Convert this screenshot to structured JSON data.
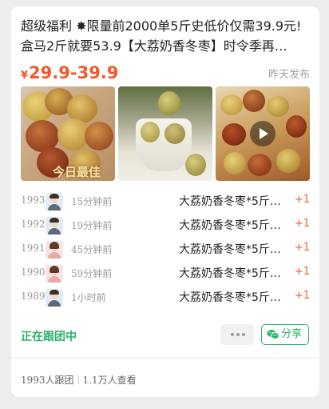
{
  "post": {
    "title_line1": "超级福利 ✸限量前2000单5斤史低价仅需39.9元!",
    "title_line2": "盒马2斤就要53.9【大荔奶香冬枣】时令季再…",
    "price_symbol": "¥",
    "price": "29.9-39.9",
    "posted": "昨天发布",
    "price_color": "#f05a2b"
  },
  "images": [
    {
      "name": "jujube-in-hand-photo",
      "watermark": "今日最佳"
    },
    {
      "name": "jujube-milk-drink-photo"
    },
    {
      "name": "jujube-plate-video",
      "icon": "play-icon"
    }
  ],
  "orders": [
    {
      "rank": "1993",
      "time": "15分钟前",
      "item": "大荔奶香冬枣*5斤…",
      "count": "+1"
    },
    {
      "rank": "1992",
      "time": "19分钟前",
      "item": "大荔奶香冬枣*5斤…",
      "count": "+1"
    },
    {
      "rank": "1991",
      "time": "45分钟前",
      "item": "大荔奶香冬枣*5斤…",
      "count": "+1"
    },
    {
      "rank": "1990",
      "time": "59分钟前",
      "item": "大荔奶香冬枣*5斤…",
      "count": "+1"
    },
    {
      "rank": "1989",
      "time": "1小时前",
      "item": "大荔奶香冬枣*5斤…",
      "count": "+1"
    }
  ],
  "actions": {
    "status": "正在跟团中",
    "more_icon": "more-dots-icon",
    "share_icon": "wechat-icon",
    "share_label": "分享",
    "accent_color": "#2bb36a"
  },
  "footer": {
    "joined": "1993人跟团",
    "views": "1.1万人查看"
  }
}
